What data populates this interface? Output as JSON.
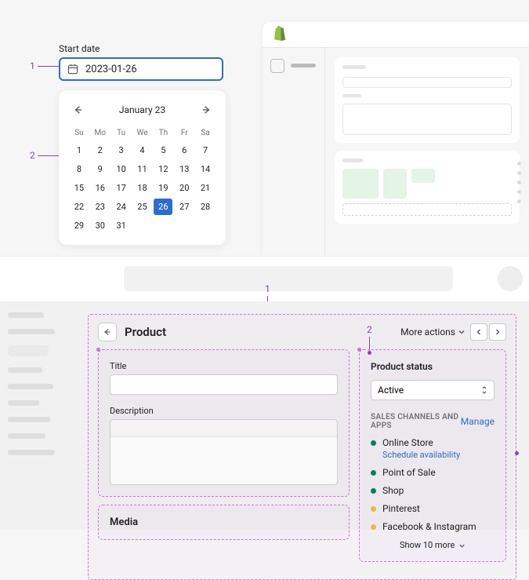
{
  "datepicker": {
    "label": "Start date",
    "value": "2023-01-26",
    "month_title": "January 23",
    "weekdays": [
      "Su",
      "Mo",
      "Tu",
      "We",
      "Th",
      "Fr",
      "Sa"
    ],
    "days": [
      "1",
      "2",
      "3",
      "4",
      "5",
      "6",
      "7",
      "8",
      "9",
      "10",
      "11",
      "12",
      "13",
      "14",
      "15",
      "16",
      "17",
      "18",
      "19",
      "20",
      "21",
      "22",
      "23",
      "24",
      "25",
      "26",
      "27",
      "28",
      "29",
      "30",
      "31"
    ],
    "selected_day": "26"
  },
  "annotations": {
    "a1": "1",
    "a2": "2",
    "b1": "1",
    "b2": "2"
  },
  "product": {
    "page_title": "Product",
    "more_actions": "More actions",
    "title_label": "Title",
    "description_label": "Description",
    "media_label": "Media",
    "status_title": "Product status",
    "status_value": "Active",
    "channels_header": "SALES CHANNELS AND APPS",
    "manage": "Manage",
    "channels": [
      {
        "name": "Online Store",
        "color": "#008060"
      },
      {
        "name": "Point of Sale",
        "color": "#008060"
      },
      {
        "name": "Shop",
        "color": "#008060"
      },
      {
        "name": "Pinterest",
        "color": "#e7b93c"
      },
      {
        "name": "Facebook & Instagram",
        "color": "#e7b93c"
      }
    ],
    "schedule": "Schedule availability",
    "show_more": "Show 10 more"
  }
}
